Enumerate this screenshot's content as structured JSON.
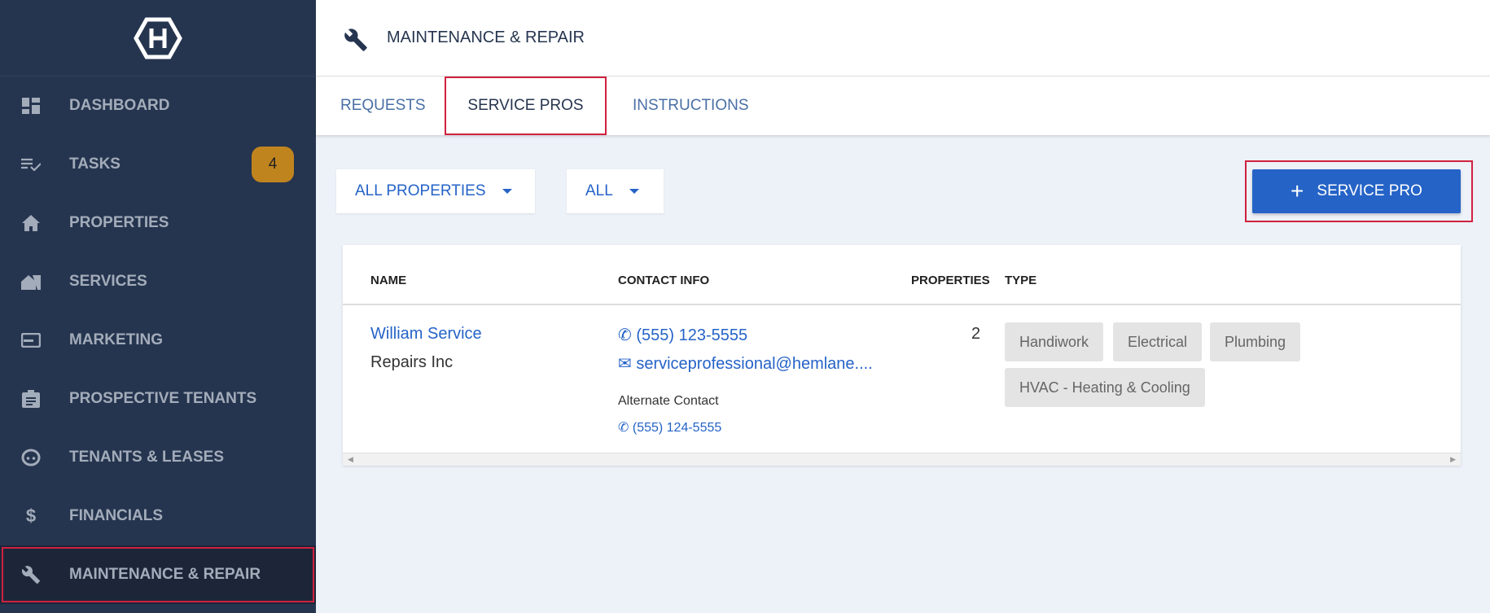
{
  "sidebar": {
    "items": [
      {
        "label": "DASHBOARD",
        "icon": "dashboard-icon"
      },
      {
        "label": "TASKS",
        "icon": "tasks-icon",
        "badge": "4"
      },
      {
        "label": "PROPERTIES",
        "icon": "home-icon"
      },
      {
        "label": "SERVICES",
        "icon": "services-icon"
      },
      {
        "label": "MARKETING",
        "icon": "marketing-icon"
      },
      {
        "label": "PROSPECTIVE TENANTS",
        "icon": "clipboard-icon"
      },
      {
        "label": "TENANTS & LEASES",
        "icon": "face-icon"
      },
      {
        "label": "FINANCIALS",
        "icon": "dollar-icon"
      },
      {
        "label": "MAINTENANCE & REPAIR",
        "icon": "wrench-icon",
        "active": true
      }
    ]
  },
  "header": {
    "title": "MAINTENANCE & REPAIR"
  },
  "tabs": [
    {
      "label": "REQUESTS"
    },
    {
      "label": "SERVICE PROS",
      "active": true
    },
    {
      "label": "INSTRUCTIONS"
    }
  ],
  "filters": {
    "property": "ALL PROPERTIES",
    "type": "ALL"
  },
  "add_button": "SERVICE PRO",
  "table": {
    "headers": [
      "NAME",
      "CONTACT INFO",
      "PROPERTIES",
      "TYPE"
    ],
    "rows": [
      {
        "name": "William Service",
        "company": "Repairs Inc",
        "phone": "(555) 123-5555",
        "email": "serviceprofessional@hemlane....",
        "alt_label": "Alternate Contact",
        "alt_phone": "(555) 124-5555",
        "properties": "2",
        "types": [
          "Handiwork",
          "Electrical",
          "Plumbing",
          "HVAC - Heating & Cooling"
        ]
      }
    ]
  },
  "colors": {
    "sidebar": "#26354f",
    "accent": "#2563c7",
    "badge": "#c0841f",
    "highlight": "#d0213f"
  }
}
